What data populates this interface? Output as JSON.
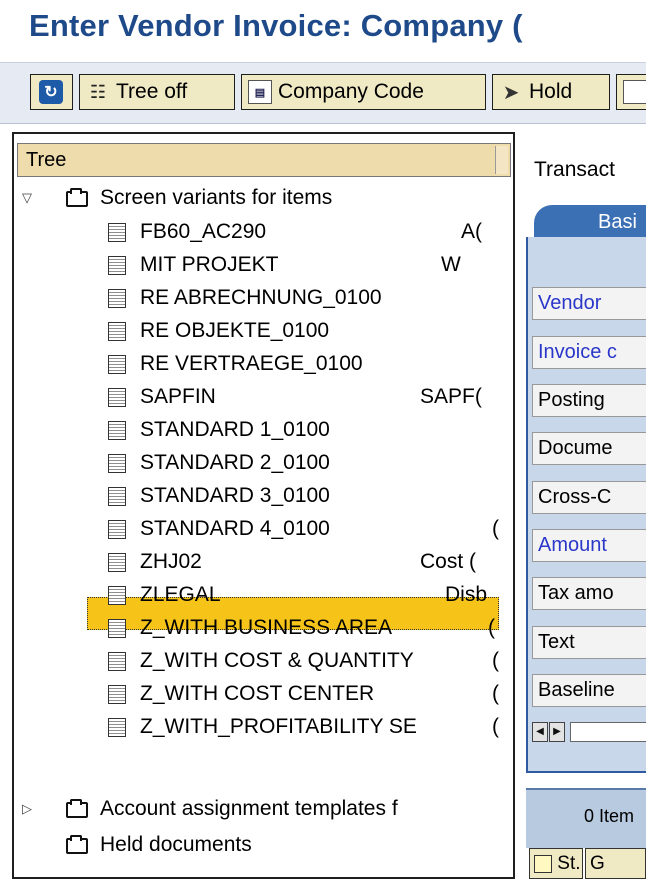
{
  "page_title": "Enter Vendor Invoice: Company (",
  "toolbar": {
    "buttons": [
      {
        "label": "",
        "icon": "refresh-icon"
      },
      {
        "label": "Tree off",
        "icon": "tree-icon"
      },
      {
        "label": "Company Code",
        "icon": "company-code-icon"
      },
      {
        "label": "Hold",
        "icon": "hold-icon"
      }
    ]
  },
  "tree": {
    "header": "Tree",
    "root_folder": "Screen variants for items",
    "items": [
      {
        "name": "FB60_AC290",
        "col": "A("
      },
      {
        "name": "MIT PROJEKT",
        "col": "W"
      },
      {
        "name": "RE ABRECHNUNG_0100",
        "col": ""
      },
      {
        "name": "RE OBJEKTE_0100",
        "col": ""
      },
      {
        "name": "RE VERTRAEGE_0100",
        "col": ""
      },
      {
        "name": "SAPFIN",
        "col": "SAPF("
      },
      {
        "name": "STANDARD 1_0100",
        "col": ""
      },
      {
        "name": "STANDARD 2_0100",
        "col": ""
      },
      {
        "name": "STANDARD 3_0100",
        "col": ""
      },
      {
        "name": "STANDARD 4_0100",
        "col": "("
      },
      {
        "name": "ZHJ02",
        "col": "Cost ("
      },
      {
        "name": "ZLEGAL",
        "col": "Disb"
      },
      {
        "name": "Z_WITH BUSINESS AREA",
        "col": "("
      },
      {
        "name": "Z_WITH COST & QUANTITY",
        "col": "("
      },
      {
        "name": "Z_WITH COST CENTER",
        "col": "("
      },
      {
        "name": "Z_WITH_PROFITABILITY SE",
        "col": "("
      }
    ],
    "selected_item": "Z_WITH COST CENTER",
    "folder_account": "Account assignment templates f",
    "folder_held": "Held documents"
  },
  "right": {
    "transaction_label": "Transact",
    "tab_basic": "Basi",
    "fields": [
      {
        "label": "Vendor",
        "required": true
      },
      {
        "label": "Invoice c",
        "required": true
      },
      {
        "label": "Posting",
        "required": false
      },
      {
        "label": "Docume",
        "required": false
      },
      {
        "label": "Cross-C",
        "required": false
      },
      {
        "label": "Amount",
        "required": true
      },
      {
        "label": "Tax amo",
        "required": false
      },
      {
        "label": "Text",
        "required": false
      },
      {
        "label": "Baseline",
        "required": false
      }
    ],
    "items_label": "0 Item",
    "bottom_buttons": [
      "St..",
      "G"
    ]
  },
  "colors": {
    "title": "#1f4a8a",
    "selected_row": "#f6c419",
    "tab": "#3b70b5",
    "required_label": "#2a37c9"
  }
}
